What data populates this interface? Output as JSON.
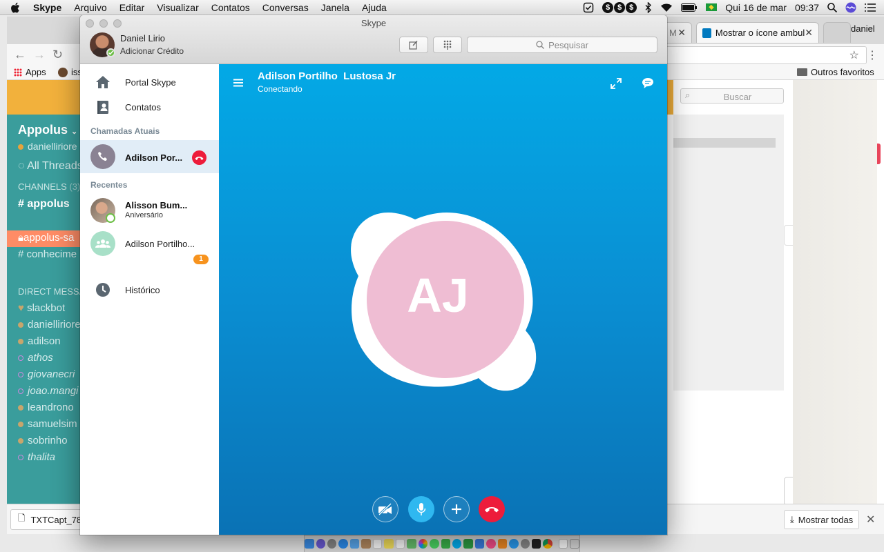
{
  "menubar": {
    "app_name": "Skype",
    "menus": [
      "Arquivo",
      "Editar",
      "Visualizar",
      "Contatos",
      "Conversas",
      "Janela",
      "Ajuda"
    ],
    "clock_date": "Qui 16 de mar",
    "clock_time": "09:37",
    "dollar_symbol": "$"
  },
  "browser": {
    "tabs": [
      {
        "label": "M"
      },
      {
        "label": "Mostrar o ícone ambul"
      }
    ],
    "profile_name": "daniel",
    "bookmarks": {
      "apps": "Apps",
      "iss": "iss",
      "other": "Outros favoritos"
    },
    "downloads": {
      "file": "TXTCapt_78",
      "show_all": "Mostrar todas"
    }
  },
  "slack": {
    "team": "Appolus",
    "user": "danielliriore",
    "all_threads": "All Threads",
    "channels_header": "CHANNELS",
    "channels_count": "(3)",
    "channels": [
      "appolus",
      "appolus-sa",
      "conhecime"
    ],
    "dm_header": "DIRECT MESSA",
    "direct_messages": [
      "slackbot",
      "danielliriore",
      "adilson",
      "athos",
      "giovanecri",
      "joao.mangi",
      "leandrono",
      "samuelsim",
      "sobrinho",
      "thalita"
    ],
    "search_placeholder": "Buscar"
  },
  "skype": {
    "window_title": "Skype",
    "user": {
      "name": "Daniel Lirio",
      "credit": "Adicionar Crédito"
    },
    "search_placeholder": "Pesquisar",
    "nav": {
      "portal": "Portal Skype",
      "contacts": "Contatos"
    },
    "sections": {
      "current_calls": "Chamadas Atuais",
      "recent": "Recentes"
    },
    "current_call": {
      "name": "Adilson Por..."
    },
    "recents": [
      {
        "name": "Alisson Bum...",
        "subtitle": "Aniversário",
        "badge": "1"
      },
      {
        "name": "Adilson Portilho..."
      }
    ],
    "history": "Histórico",
    "call": {
      "name": "Adilson Portilho  Lustosa Jr",
      "status": "Conectando",
      "initials": "AJ",
      "avatar_color": "#efbdd3"
    },
    "colors": {
      "accent": "#00aff0",
      "hangup": "#ed1c3b",
      "badge": "#f7931e",
      "online": "#6cbe45"
    }
  }
}
